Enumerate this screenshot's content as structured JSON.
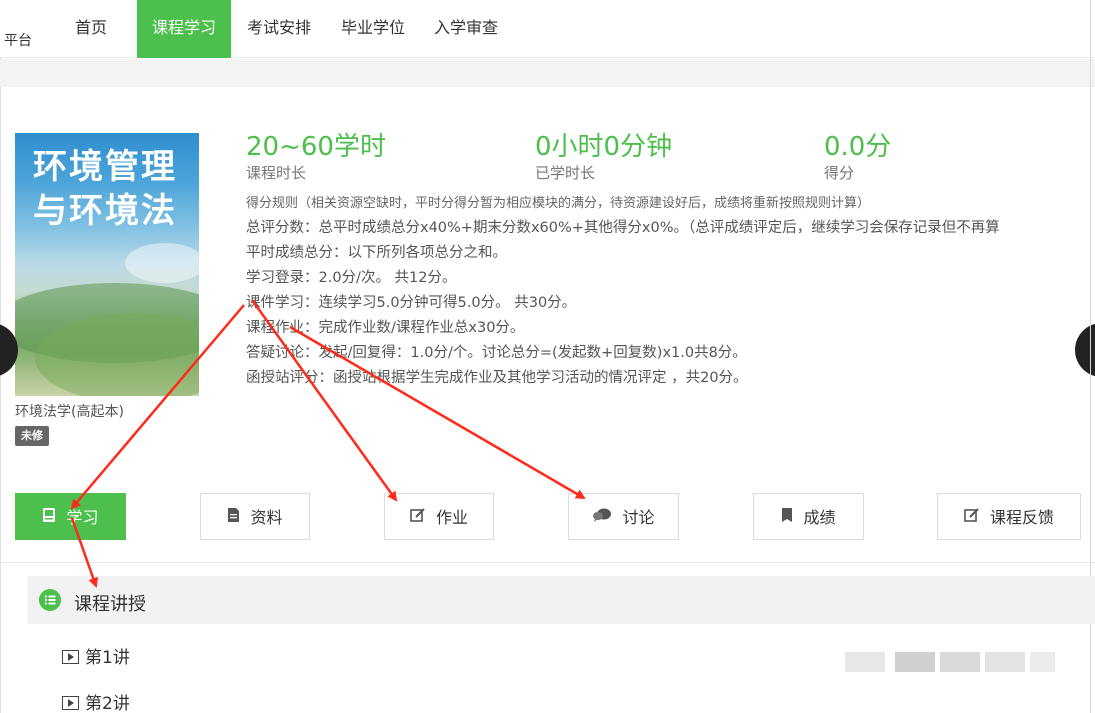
{
  "header": {
    "brand": "平台",
    "nav": [
      {
        "label": "首页"
      },
      {
        "label": "课程学习"
      },
      {
        "label": "考试安排"
      },
      {
        "label": "毕业学位"
      },
      {
        "label": "入学审查"
      }
    ],
    "active_color": "#4cbf4c"
  },
  "course": {
    "cover_title_line1": "环境管理",
    "cover_title_line2": "与环境法",
    "name": "环境法学(高起本)",
    "status": "未修"
  },
  "stats": [
    {
      "value": "20~60学时",
      "label": "课程时长"
    },
    {
      "value": "0小时0分钟",
      "label": "已学时长"
    },
    {
      "value": "0.0分",
      "label": "得分"
    }
  ],
  "rules": {
    "title": "得分规则（相关资源空缺时，平时分得分暂为相应模块的满分，待资源建设好后，成绩将重新按照规则计算）",
    "total": "总评分数：总平时成绩总分x40%+期末分数x60%+其他得分x0%。（总评成绩评定后，继续学习会保存记录但不再算",
    "usual": "平时成绩总分：以下所列各项总分之和。",
    "login": "学习登录：2.0分/次。 共12分。",
    "courseware": "课件学习：连续学习5.0分钟可得5.0分。 共30分。",
    "homework": "课程作业：完成作业数/课程作业总x30分。",
    "discussion": "答疑讨论：发起/回复得：1.0分/个。讨论总分=(发起数+回复数)x1.0共8分。",
    "station": "函授站评分：函授站根据学生完成作业及其他学习活动的情况评定 ，共20分。"
  },
  "tabs": [
    {
      "label": "学习",
      "icon": "book-icon"
    },
    {
      "label": "资料",
      "icon": "document-icon"
    },
    {
      "label": "作业",
      "icon": "edit-icon"
    },
    {
      "label": "讨论",
      "icon": "chat-icon"
    },
    {
      "label": "成绩",
      "icon": "bookmark-icon"
    },
    {
      "label": "课程反馈",
      "icon": "edit-icon"
    }
  ],
  "section": {
    "title": "课程讲授",
    "lectures": [
      {
        "label": "第1讲"
      },
      {
        "label": "第2讲"
      }
    ]
  },
  "annotation_color": "#ff2a1a"
}
